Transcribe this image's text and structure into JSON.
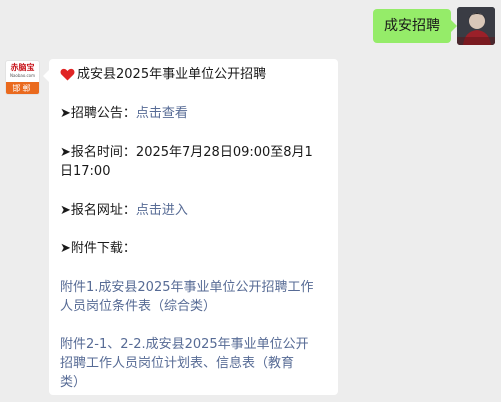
{
  "outgoing": {
    "text": "成安招聘"
  },
  "bot": {
    "logo_top": "赤脑宝",
    "logo_sub": "Naobao.com",
    "logo_bottom": "邯郸"
  },
  "message": {
    "title": "成安县2025年事业单位公开招聘",
    "arrow": "➤",
    "notice_label": "招聘公告：",
    "notice_link": "点击查看",
    "time_label": "报名时间：",
    "time_value_1": "2025年7月28日09:00至8月1",
    "time_value_2": "日17:00",
    "url_label": "报名网址：",
    "url_link": "点击进入",
    "attach_label": "附件下载：",
    "attach1_line1": "附件1.成安县2025年事业单位公开招聘工作",
    "attach1_line2": "人员岗位条件表（综合类）",
    "attach2_line1": "附件2-1、2-2.成安县2025年事业单位公开",
    "attach2_line2": "招聘工作人员岗位计划表、信息表（教育",
    "attach2_line3": "类）"
  },
  "colors": {
    "background": "#ededed",
    "outgoing_bubble": "#95ec69",
    "incoming_bubble": "#ffffff",
    "link": "#576b95",
    "heart": "#e02424"
  }
}
